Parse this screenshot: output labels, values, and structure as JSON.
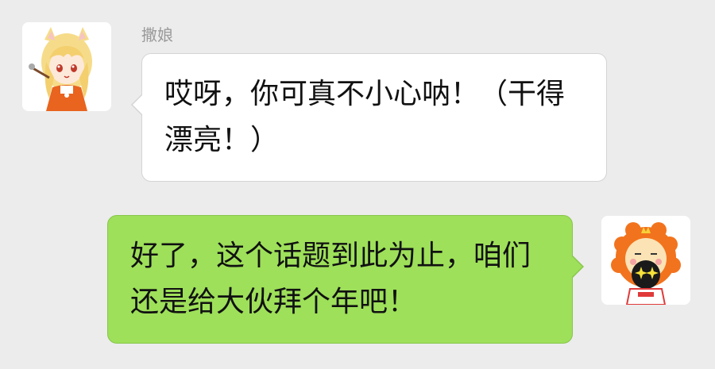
{
  "chat": {
    "messages": [
      {
        "direction": "incoming",
        "sender": "撒娘",
        "avatar_icon": "anime-girl-avatar-icon",
        "text": "哎呀，你可真不小心呐！（干得漂亮！）"
      },
      {
        "direction": "outgoing",
        "avatar_icon": "lion-mascot-avatar-icon",
        "text": "好了，这个话题到此为止，咱们还是给大伙拜个年吧！"
      }
    ]
  },
  "colors": {
    "background": "#ececec",
    "incoming_bubble": "#ffffff",
    "outgoing_bubble": "#9ee05a",
    "sender_name": "#9a9a9a"
  }
}
